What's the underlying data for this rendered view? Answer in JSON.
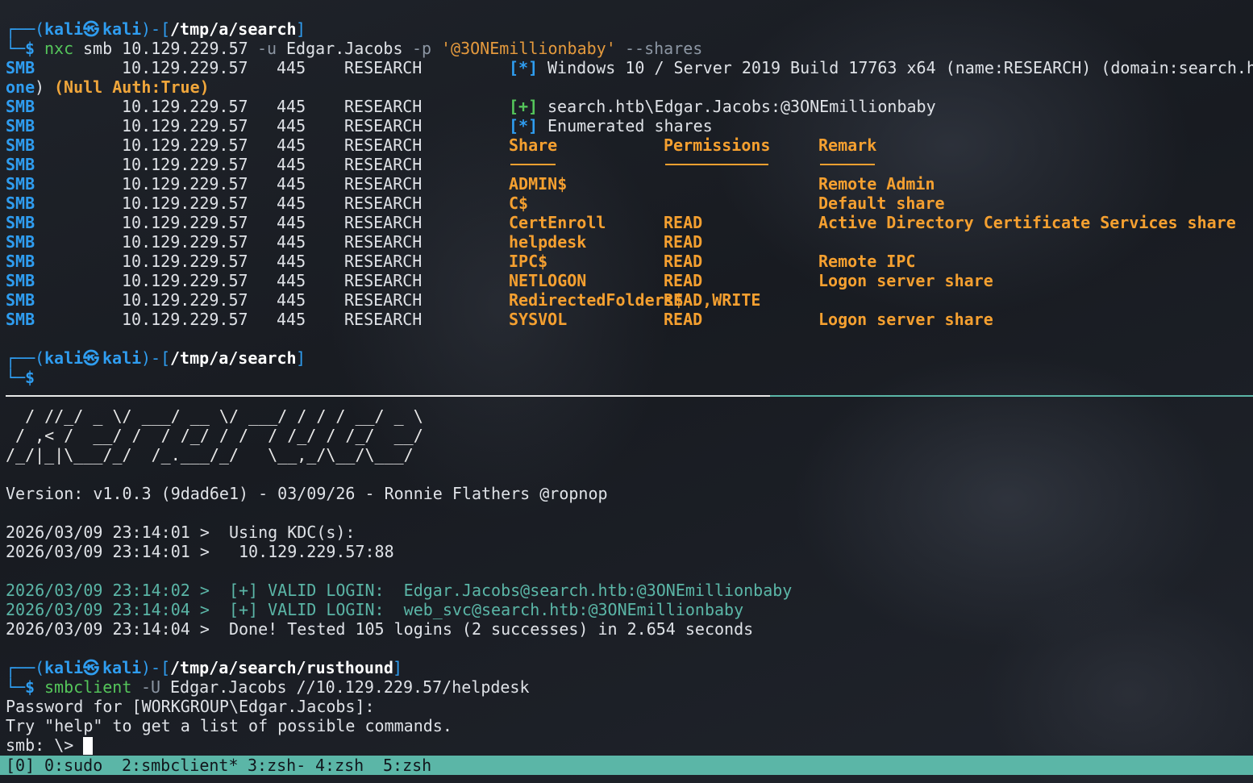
{
  "prompt1": {
    "user": "kali",
    "sep_glyph": "㉿",
    "host": "kali",
    "dir": "/tmp/a/search",
    "dollar": "$",
    "cmd_bin": "nxc",
    "cmd_a": "smb 10.129.229.57",
    "cmd_u": "-u",
    "cmd_user": "Edgar.Jacobs",
    "cmd_p": "-p",
    "cmd_pass": "'@3ONEmillionbaby'",
    "cmd_shares": "--shares"
  },
  "smb": {
    "tag": "SMB",
    "ip": "10.129.229.57",
    "port": "445",
    "host": "RESEARCH",
    "info_marker": "[*]",
    "info_text": "Windows 10 / Server 2019 Build 17763 x64 (name:RESEARCH) (domain:search.h",
    "info_wrap_a": "one",
    "info_wrap_b": ")",
    "null_auth": "(Null Auth:True)",
    "login_marker": "[+]",
    "login_text": "search.htb\\Edgar.Jacobs:@3ONEmillionbaby",
    "enum_marker": "[*]",
    "enum_text": "Enumerated shares",
    "col_share": "Share",
    "col_perm": "Permissions",
    "col_remark": "Remark",
    "shares": [
      {
        "name": "ADMIN$",
        "perm": "",
        "remark": "Remote Admin"
      },
      {
        "name": "C$",
        "perm": "",
        "remark": "Default share"
      },
      {
        "name": "CertEnroll",
        "perm": "READ",
        "remark": "Active Directory Certificate Services share"
      },
      {
        "name": "helpdesk",
        "perm": "READ",
        "remark": ""
      },
      {
        "name": "IPC$",
        "perm": "READ",
        "remark": "Remote IPC"
      },
      {
        "name": "NETLOGON",
        "perm": "READ",
        "remark": "Logon server share"
      },
      {
        "name": "RedirectedFolders$",
        "perm": "READ,WRITE",
        "remark": ""
      },
      {
        "name": "SYSVOL",
        "perm": "READ",
        "remark": "Logon server share"
      }
    ]
  },
  "prompt2": {
    "user": "kali",
    "sep_glyph": "㉿",
    "host": "kali",
    "dir": "/tmp/a/search",
    "dollar": "$"
  },
  "kerbrute": {
    "ascii1": "  / //_/ _ \\/ ___/ __ \\/ ___/ / / / __/ _ \\",
    "ascii2": " / ,< /  __/ /  / /_/ / /  / /_/ / /_/  __/",
    "ascii3": "/_/|_|\\___/_/  /_.___/_/   \\__,_/\\__/\\___/",
    "version": "Version: v1.0.3 (9dad6e1) - 03/09/26 - Ronnie Flathers @ropnop",
    "kdc1": "2026/03/09 23:14:01 >  Using KDC(s):",
    "kdc2": "2026/03/09 23:14:01 >   10.129.229.57:88",
    "valid1": "2026/03/09 23:14:02 >  [+] VALID LOGIN:  Edgar.Jacobs@search.htb:@3ONEmillionbaby",
    "valid2": "2026/03/09 23:14:04 >  [+] VALID LOGIN:  web_svc@search.htb:@3ONEmillionbaby",
    "done": "2026/03/09 23:14:04 >  Done! Tested 105 logins (2 successes) in 2.654 seconds"
  },
  "prompt3": {
    "user": "kali",
    "sep_glyph": "㉿",
    "host": "kali",
    "dir": "/tmp/a/search/rusthound",
    "dollar": "$",
    "cmd_bin": "smbclient",
    "cmd_u": "-U",
    "cmd_rest": "Edgar.Jacobs //10.129.229.57/helpdesk"
  },
  "smbclient": {
    "pw": "Password for [WORKGROUP\\Edgar.Jacobs]:",
    "help": "Try \"help\" to get a list of possible commands.",
    "prompt": "smb: \\> "
  },
  "tmux": {
    "session": "[0]",
    "windows": [
      {
        "label": "0:sudo"
      },
      {
        "label": "2:smbclient*"
      },
      {
        "label": "3:zsh-"
      },
      {
        "label": "4:zsh"
      },
      {
        "label": "5:zsh"
      }
    ]
  },
  "colors": {
    "blue": "#2f9df0",
    "green": "#55c65b",
    "orange": "#f5a030",
    "teal": "#5bb6a7",
    "background": "#1b1e24"
  }
}
